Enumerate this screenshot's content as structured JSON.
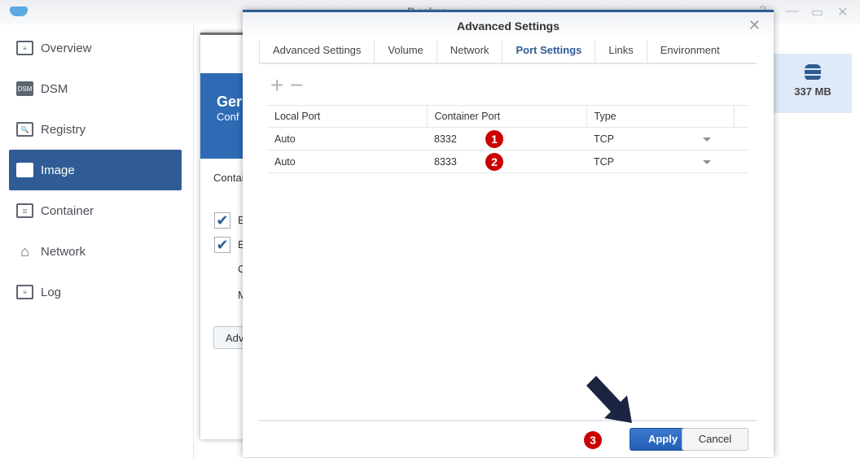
{
  "app": {
    "title": "Docker"
  },
  "sidebar": {
    "items": [
      {
        "label": "Overview",
        "icon": "overview-icon"
      },
      {
        "label": "DSM",
        "icon": "dsm-icon"
      },
      {
        "label": "Registry",
        "icon": "registry-icon"
      },
      {
        "label": "Image",
        "icon": "image-icon",
        "active": true
      },
      {
        "label": "Container",
        "icon": "container-icon"
      },
      {
        "label": "Network",
        "icon": "network-icon"
      },
      {
        "label": "Log",
        "icon": "log-icon"
      }
    ]
  },
  "storage": {
    "value": "337 MB"
  },
  "wizard": {
    "title": "Ger",
    "subtitle": "Conf",
    "label": "Contai",
    "check1": "E",
    "check2": "E",
    "field1": "C",
    "field2": "M",
    "adv_button": "Adv"
  },
  "dialog": {
    "title": "Advanced Settings",
    "tabs": [
      "Advanced Settings",
      "Volume",
      "Network",
      "Port Settings",
      "Links",
      "Environment"
    ],
    "active_tab": "Port Settings",
    "columns": [
      "Local Port",
      "Container Port",
      "Type"
    ],
    "rows": [
      {
        "local": "Auto",
        "container": "8332",
        "type": "TCP",
        "badge": "1"
      },
      {
        "local": "Auto",
        "container": "8333",
        "type": "TCP",
        "badge": "2"
      }
    ],
    "apply": "Apply",
    "cancel": "Cancel",
    "apply_badge": "3"
  },
  "colors": {
    "accent": "#2f5c94",
    "badge": "#cc0000",
    "header": "#2e6bb4"
  }
}
